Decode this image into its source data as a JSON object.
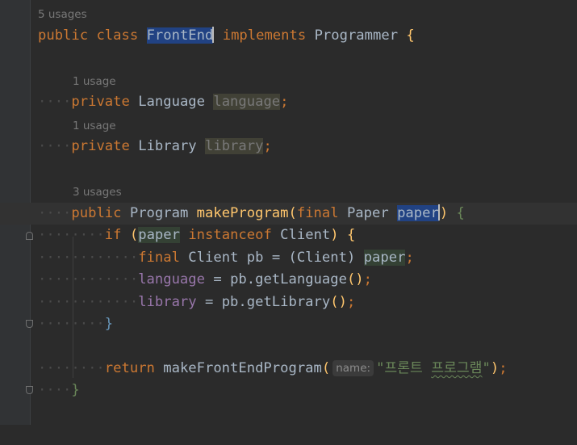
{
  "hints": {
    "class_usages": "5 usages",
    "language_usages": "1 usage",
    "library_usages": "1 usage",
    "method_usages": "3 usages"
  },
  "code": {
    "l1": {
      "public": "public",
      "class": "class",
      "name": "FrontEnd",
      "implements": "implements",
      "iface": "Programmer",
      "brace": "{"
    },
    "l2": {
      "private": "private",
      "type": "Language",
      "field": "language",
      "semi": ";"
    },
    "l3": {
      "private": "private",
      "type": "Library",
      "field": "library",
      "semi": ";"
    },
    "l4": {
      "public": "public",
      "type": "Program",
      "method": "makeProgram",
      "lparen": "(",
      "final": "final",
      "ptype": "Paper",
      "pname": "paper",
      "rparen": ")",
      "brace": "{"
    },
    "l5": {
      "if": "if",
      "lparen": "(",
      "var": "paper",
      "instanceof": "instanceof",
      "type": "Client",
      "rparen": ")",
      "brace": "{"
    },
    "l6": {
      "final": "final",
      "type": "Client",
      "var": "pb",
      "eq": "=",
      "cast": "(Client)",
      "src": "paper",
      "semi": ";"
    },
    "l7": {
      "field": "language",
      "eq": "=",
      "call": "pb.getLanguage",
      "parens": "()",
      "semi": ";"
    },
    "l8": {
      "field": "library",
      "eq": "=",
      "call": "pb.getLibrary",
      "parens": "()",
      "semi": ";"
    },
    "l9": {
      "brace": "}"
    },
    "l10": {
      "return": "return",
      "call": "makeFrontEndProgram",
      "lparen": "(",
      "param_hint": "name:",
      "q1": "\"",
      "s1": "프론트",
      "space": " ",
      "s2": "프로그램",
      "q2": "\"",
      "rparen": ")",
      "semi": ";"
    },
    "l11": {
      "brace": "}"
    }
  },
  "colors": {
    "background": "#2b2b2b",
    "keyword": "#cc7832",
    "method": "#ffc66d",
    "field": "#9876aa",
    "string": "#6a8759",
    "text": "#a9b7c6",
    "selection": "#214283"
  },
  "gutter_icons": [
    "overridden-method-icon",
    "fold-toggle-icon"
  ]
}
